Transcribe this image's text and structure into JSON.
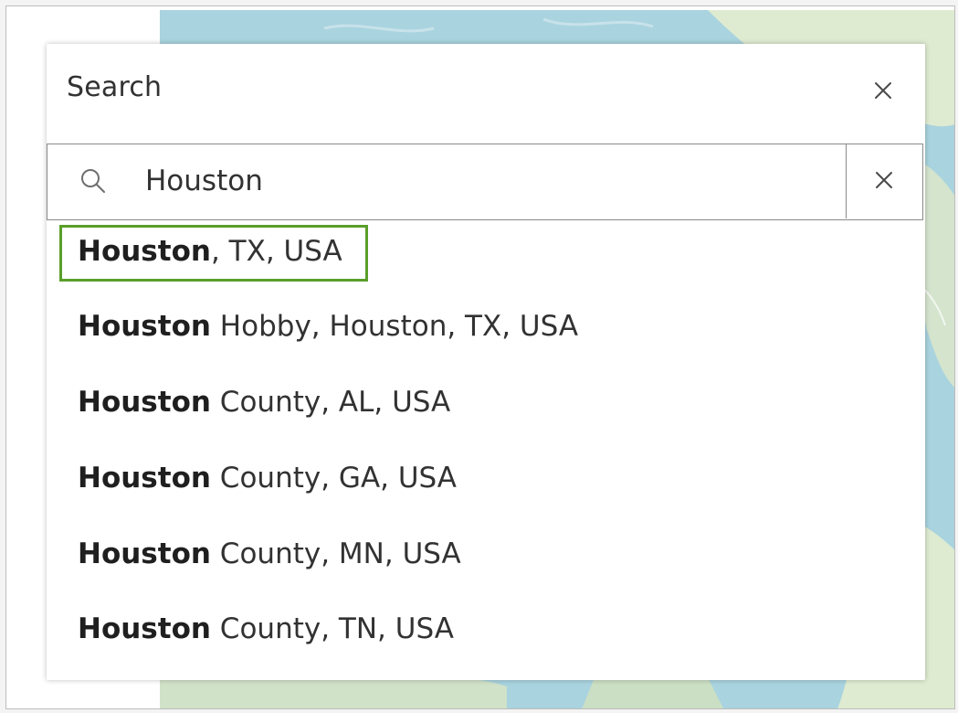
{
  "panel": {
    "title": "Search"
  },
  "search": {
    "value": "Houston",
    "placeholder": ""
  },
  "suggestions": [
    {
      "match": "Houston",
      "rest": ", TX, USA",
      "highlighted": true
    },
    {
      "match": "Houston",
      "rest": " Hobby, Houston, TX, USA",
      "highlighted": false
    },
    {
      "match": "Houston",
      "rest": " County, AL, USA",
      "highlighted": false
    },
    {
      "match": "Houston",
      "rest": " County, GA, USA",
      "highlighted": false
    },
    {
      "match": "Houston",
      "rest": " County, MN, USA",
      "highlighted": false
    },
    {
      "match": "Houston",
      "rest": " County, TN, USA",
      "highlighted": false
    }
  ],
  "icons": {
    "close": "close-icon",
    "search": "search-icon",
    "clear": "clear-icon"
  },
  "colors": {
    "highlight_border": "#5a9e2a",
    "map_water": "#a9d3df",
    "map_land": "#e7eecf"
  }
}
